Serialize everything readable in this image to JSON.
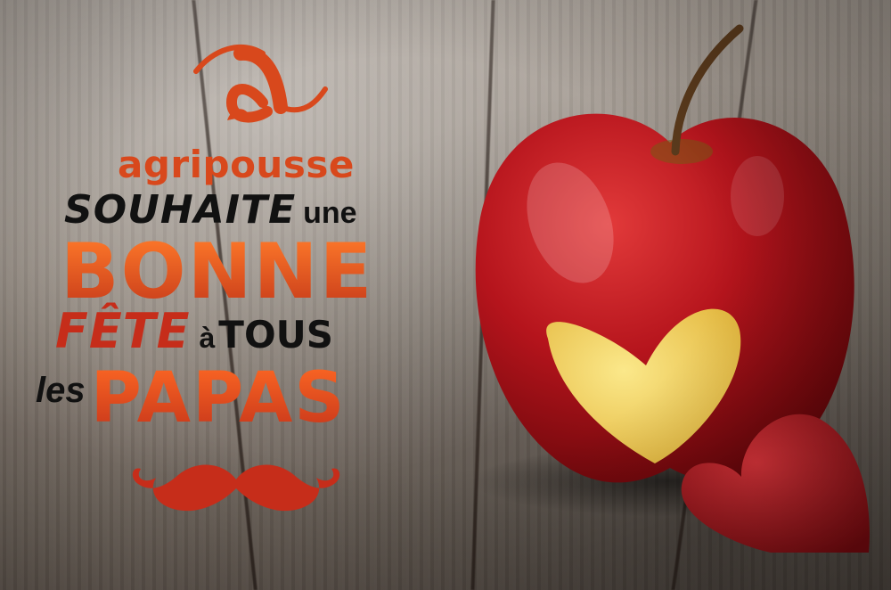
{
  "brand": {
    "name": "agripousse",
    "logo_icon": "agripousse-logo-icon",
    "color": "#d8481c"
  },
  "message": {
    "souhaite": "SOUHAITE",
    "une": "une",
    "bonne": "BONNE",
    "fete": "FÊTE",
    "a": "à",
    "tous": "TOUS",
    "les": "les",
    "papas": "PAPAS"
  },
  "decorations": {
    "mustache_icon": "mustache-icon",
    "apple_icon": "apple-with-heart-icon",
    "heart_slice_icon": "apple-heart-slice-icon"
  },
  "colors": {
    "accent_orange": "#e05a1c",
    "accent_red": "#c62d1a",
    "text_dark": "#111111",
    "apple_red": "#b5141c",
    "heart_yellow": "#f3d35c"
  }
}
